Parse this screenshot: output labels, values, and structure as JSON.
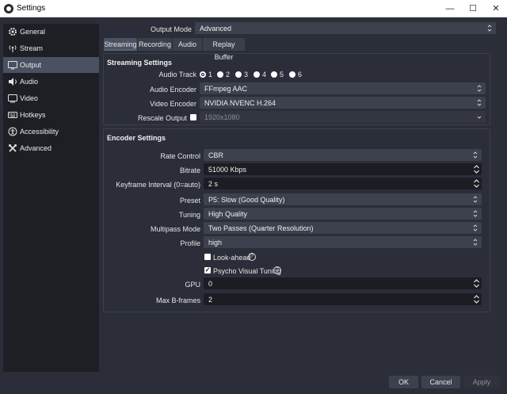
{
  "window": {
    "title": "Settings",
    "minimize": "—",
    "maximize": "☐",
    "close": "✕"
  },
  "sidebar": {
    "items": [
      {
        "label": "General",
        "icon": "gear-icon"
      },
      {
        "label": "Stream",
        "icon": "broadcast-icon"
      },
      {
        "label": "Output",
        "icon": "monitor-output-icon"
      },
      {
        "label": "Audio",
        "icon": "speaker-icon"
      },
      {
        "label": "Video",
        "icon": "video-monitor-icon"
      },
      {
        "label": "Hotkeys",
        "icon": "keyboard-icon"
      },
      {
        "label": "Accessibility",
        "icon": "accessibility-icon"
      },
      {
        "label": "Advanced",
        "icon": "wrench-icon"
      }
    ],
    "active": "Output"
  },
  "output_mode": {
    "label": "Output Mode",
    "value": "Advanced"
  },
  "tabs": [
    "Streaming",
    "Recording",
    "Audio",
    "Replay Buffer"
  ],
  "streaming_settings": {
    "title": "Streaming Settings",
    "audio_track": {
      "label": "Audio Track",
      "options": [
        "1",
        "2",
        "3",
        "4",
        "5",
        "6"
      ],
      "selected": "1"
    },
    "audio_encoder": {
      "label": "Audio Encoder",
      "value": "FFmpeg AAC"
    },
    "video_encoder": {
      "label": "Video Encoder",
      "value": "NVIDIA NVENC H.264"
    },
    "rescale_output": {
      "label": "Rescale Output",
      "checked": false,
      "value": "1920x1080"
    }
  },
  "encoder_settings": {
    "title": "Encoder Settings",
    "rate_control": {
      "label": "Rate Control",
      "value": "CBR"
    },
    "bitrate": {
      "label": "Bitrate",
      "value": "51000 Kbps"
    },
    "keyframe_interval": {
      "label": "Keyframe Interval (0=auto)",
      "value": "2 s"
    },
    "preset": {
      "label": "Preset",
      "value": "P5: Slow (Good Quality)"
    },
    "tuning": {
      "label": "Tuning",
      "value": "High Quality"
    },
    "multipass_mode": {
      "label": "Multipass Mode",
      "value": "Two Passes (Quarter Resolution)"
    },
    "profile": {
      "label": "Profile",
      "value": "high"
    },
    "look_ahead": {
      "label": "Look-ahead",
      "checked": false,
      "help": "?"
    },
    "psycho_visual_tuning": {
      "label": "Psycho Visual Tuning",
      "checked": true,
      "help": "?"
    },
    "gpu": {
      "label": "GPU",
      "value": "0"
    },
    "max_b_frames": {
      "label": "Max B-frames",
      "value": "2"
    }
  },
  "buttons": {
    "ok": "OK",
    "cancel": "Cancel",
    "apply": "Apply"
  },
  "colors": {
    "background": "#2b2e38",
    "sidebar": "#1e1f24",
    "active": "#4a5162",
    "combo": "#3d414d",
    "input": "#1c1d22"
  }
}
